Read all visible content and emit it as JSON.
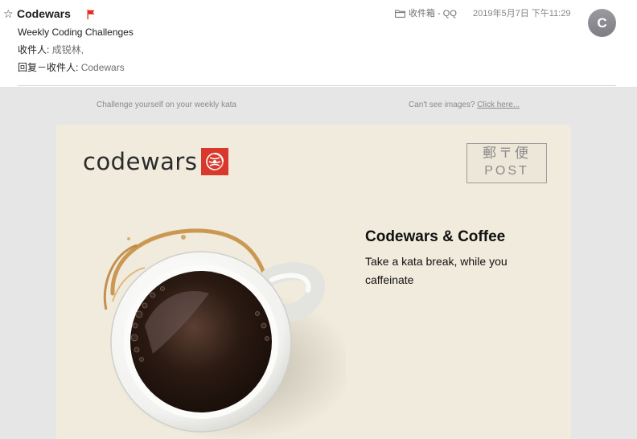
{
  "header": {
    "sender": "Codewars",
    "subject": "Weekly Coding Challenges",
    "to_label": "收件人:",
    "to_value": "成锐林,",
    "reply_to_label": "回复－收件人:",
    "reply_to_value": "Codewars",
    "folder": "收件箱 - QQ",
    "date": "2019年5月7日 下午11:29",
    "avatar_initial": "C",
    "icons": {
      "star": "star-icon",
      "flag": "flag-icon",
      "folder": "folder-icon"
    }
  },
  "email": {
    "preheader": "Challenge yourself on your weekly kata",
    "cant_see_text": "Can't see images?",
    "cant_see_link": "Click here...",
    "logo_text": "codewars",
    "stamp_jp": "郵〒便",
    "stamp_en": "POST",
    "promo_title": "Codewars & Coffee",
    "promo_text": "Take a kata break, while you caffeinate"
  },
  "colors": {
    "flag": "#e0281e",
    "body_bg": "#e6e6e6",
    "card_bg": "#f0ebdc",
    "logo_red": "#d8392c",
    "avatar": "#8a8a90"
  }
}
